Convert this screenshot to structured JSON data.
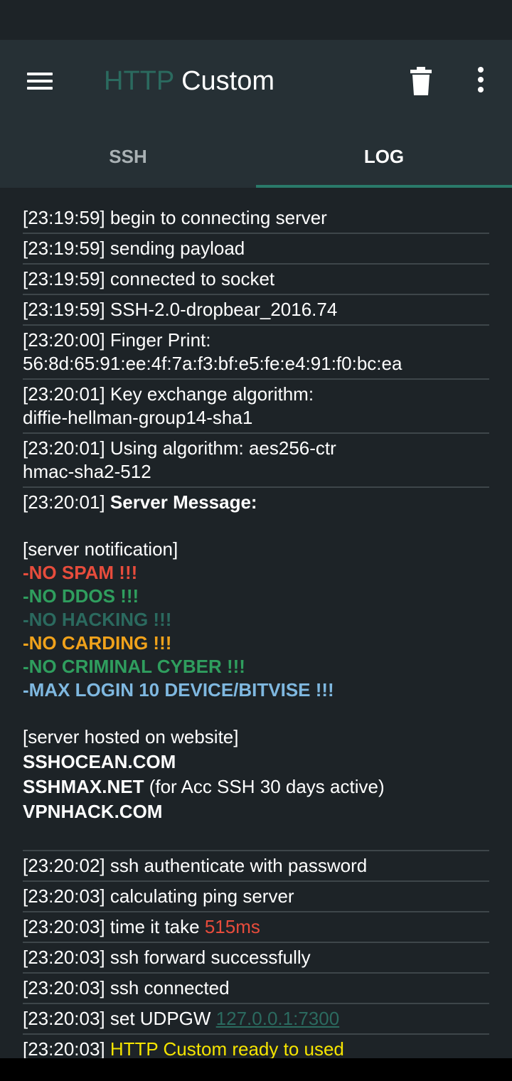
{
  "app": {
    "title_part1": "HTTP",
    "title_part2": "Custom"
  },
  "icons": {
    "menu": "hamburger-menu-icon",
    "trash": "trash-icon",
    "more": "more-vert-icon"
  },
  "tabs": [
    {
      "label": "SSH",
      "active": false
    },
    {
      "label": "LOG",
      "active": true
    }
  ],
  "colors": {
    "accent": "#2a7a6a",
    "red": "#e74c3c",
    "green": "#2f9e5e",
    "orange": "#f0a21b",
    "blue": "#7fb8e0",
    "yellow": "#f5e400"
  },
  "log": {
    "l1": "[23:19:59] begin to connecting server",
    "l2": "[23:19:59] sending payload",
    "l3": "[23:19:59] connected to socket",
    "l4": "[23:19:59] SSH-2.0-dropbear_2016.74",
    "l5a": "[23:20:00] Finger Print:",
    "l5b": "56:8d:65:91:ee:4f:7a:f3:bf:e5:fe:e4:91:f0:bc:ea",
    "l6a": "[23:20:01] Key exchange algorithm:",
    "l6b": "diffie-hellman-group14-sha1",
    "l7a": "[23:20:01] Using algorithm: aes256-ctr",
    "l7b": "hmac-sha2-512",
    "l8_time": "[23:20:01] ",
    "l8_label": "Server Message:",
    "notification_header": "[server notification]",
    "rule1": "-NO SPAM !!!",
    "rule2": "-NO DDOS !!!",
    "rule3": "-NO HACKING !!!",
    "rule4": "-NO CARDING !!!",
    "rule5": "-NO CRIMINAL CYBER !!!",
    "rule6": "-MAX LOGIN 10 DEVICE/BITVISE !!!",
    "hosted_header": "[server hosted on website]",
    "site1": "SSHOCEAN.COM",
    "site2": "SSHMAX.NET",
    "site2_note": " (for Acc SSH 30 days active)",
    "site3": "VPNHACK.COM",
    "l9": "[23:20:02] ssh authenticate with password",
    "l10": "[23:20:03] calculating ping server",
    "l11_text": "[23:20:03] time it take ",
    "l11_value": "515ms",
    "l12": "[23:20:03] ssh forward successfully",
    "l13": "[23:20:03] ssh connected",
    "l14_text": "[23:20:03] set UDPGW ",
    "l14_value": "127.0.0.1:7300",
    "l15_time": "[23:20:03] ",
    "l15_text": "HTTP Custom ready to used"
  }
}
